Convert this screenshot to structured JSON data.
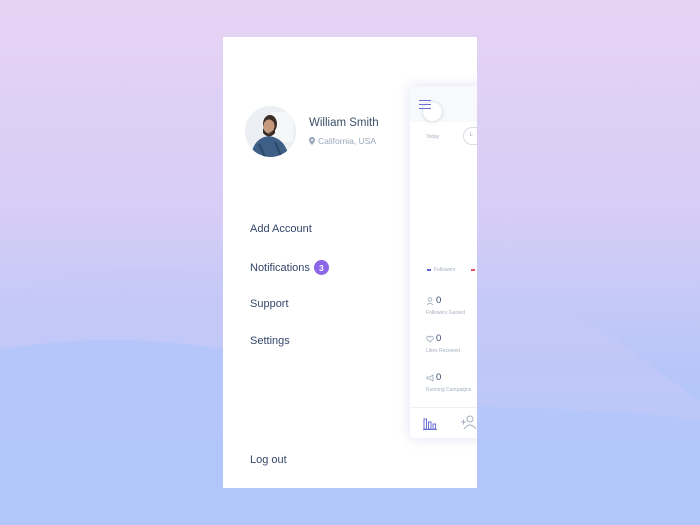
{
  "colors": {
    "accent": "#8b66e8",
    "text": "#34476a",
    "muted": "#9aa8ba",
    "followers_legend": "#5b62d6",
    "second_legend": "#e84d6b"
  },
  "profile": {
    "name": "William Smith",
    "location": "California, USA",
    "location_icon": "location-pin-icon",
    "avatar_icon": "avatar"
  },
  "menu": {
    "add_account": "Add Account",
    "notifications": "Notifications",
    "notifications_count": "3",
    "support": "Support",
    "settings": "Settings",
    "logout": "Log out"
  },
  "dashboard": {
    "today_label": "Today",
    "pill_label": "L",
    "legend_followers": "Followers",
    "stats": [
      {
        "value": "0",
        "label": "Followers Gained",
        "icon": "user-icon"
      },
      {
        "value": "0",
        "label": "Likes Received",
        "icon": "heart-icon"
      },
      {
        "value": "0",
        "label": "Running Campaigns",
        "icon": "megaphone-icon"
      }
    ],
    "bottom_icons": [
      "bar-chart-icon",
      "add-user-icon"
    ]
  }
}
